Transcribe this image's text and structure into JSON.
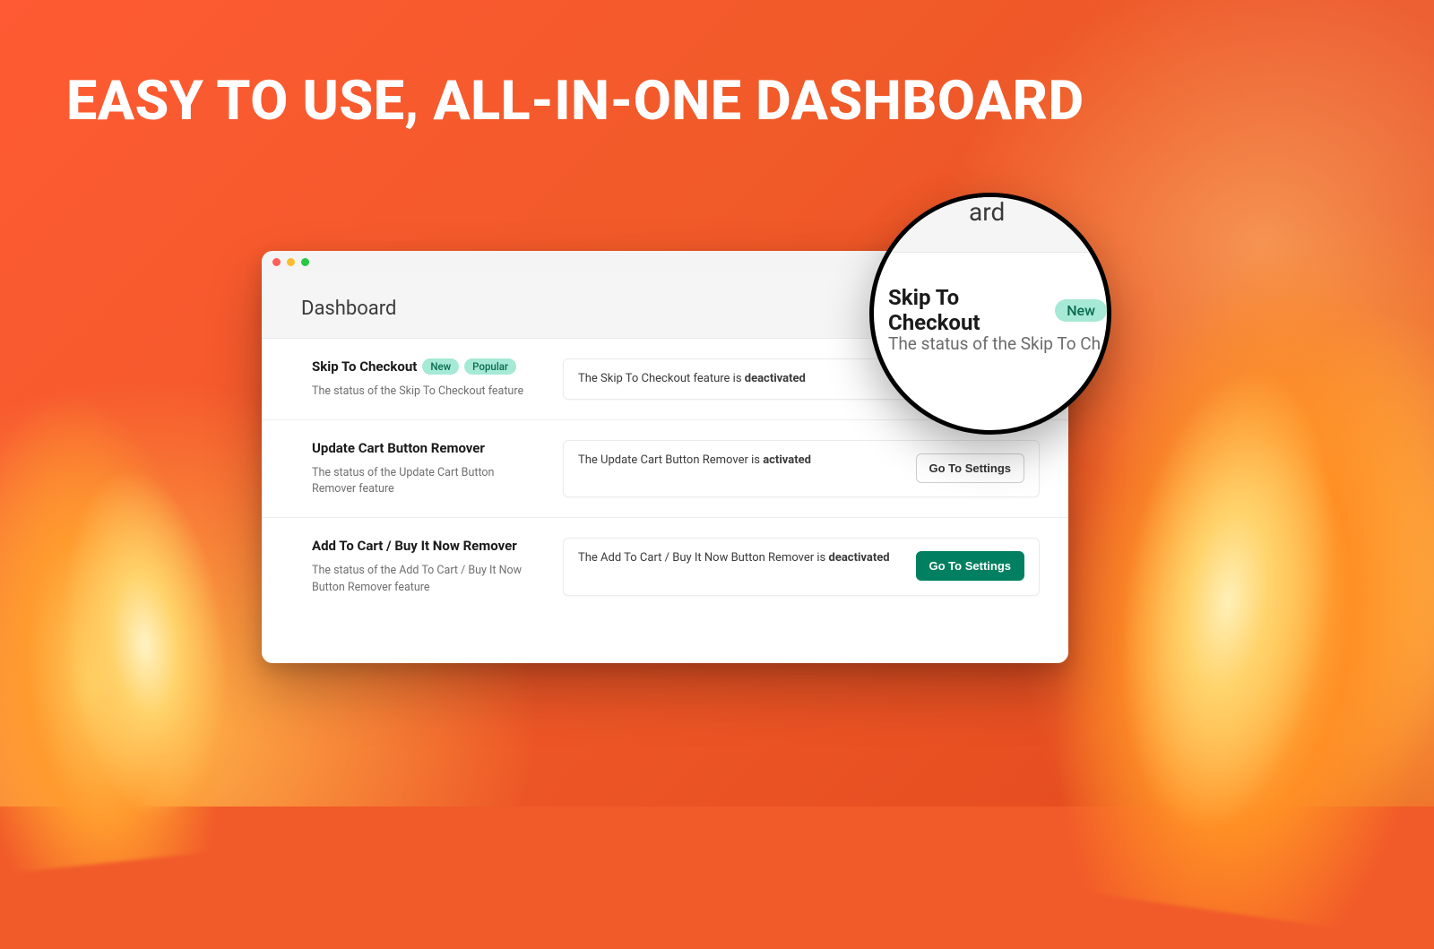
{
  "headline": "EASY TO USE, ALL-IN-ONE DASHBOARD",
  "window": {
    "title": "Dashboard"
  },
  "badges": {
    "new": "New",
    "popular": "Popular"
  },
  "rows": [
    {
      "title": "Skip To Checkout",
      "badges": [
        "new",
        "popular"
      ],
      "subtitle": "The status of the Skip To Checkout feature",
      "status_prefix": "The Skip To Checkout feature is ",
      "status_value": "deactivated",
      "button": null
    },
    {
      "title": "Update Cart Button Remover",
      "badges": [],
      "subtitle": "The status of the Update Cart Button Remover feature",
      "status_prefix": "The Update Cart Button Remover is ",
      "status_value": "activated",
      "button": {
        "label": "Go To Settings",
        "style": "outline"
      }
    },
    {
      "title": "Add To Cart / Buy It Now Remover",
      "badges": [],
      "subtitle": "The status of the Add To Cart / Buy It Now Button Remover feature",
      "status_prefix": "The Add To Cart / Buy It Now Button Remover is ",
      "status_value": "deactivated",
      "button": {
        "label": "Go To Settings",
        "style": "primary"
      }
    }
  ],
  "magnifier": {
    "fragment": "ard",
    "title": "Skip To Checkout",
    "badge": "New",
    "subtitle": "The status of the Skip To Ch"
  }
}
